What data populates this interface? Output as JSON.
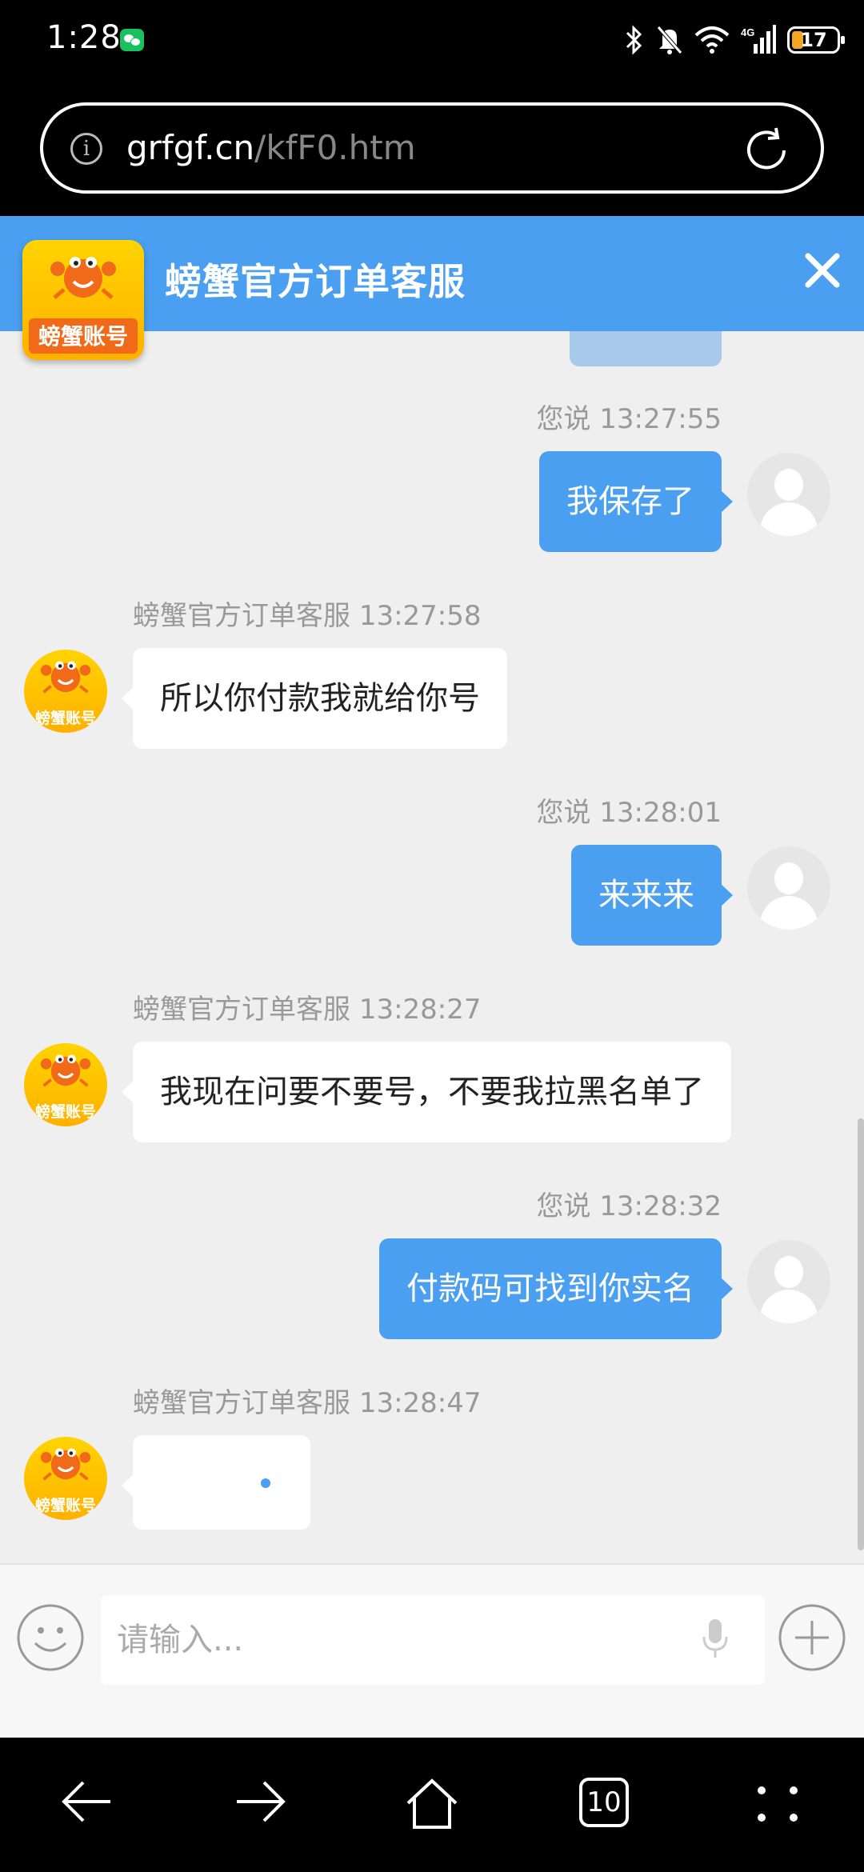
{
  "status_bar": {
    "time": "1:28",
    "battery": "17"
  },
  "browser": {
    "url_domain": "grfgf.cn",
    "url_path": "/kfF0.htm",
    "tabs_count": "10"
  },
  "chat": {
    "title": "螃蟹官方订单客服",
    "logo_text": "螃蟹账号",
    "messages": [
      {
        "sender": "您说",
        "time": "13:27:55",
        "text": "我保存了"
      },
      {
        "sender": "螃蟹官方订单客服",
        "time": "13:27:58",
        "text": "所以你付款我就给你号"
      },
      {
        "sender": "您说",
        "time": "13:28:01",
        "text": "来来来"
      },
      {
        "sender": "螃蟹官方订单客服",
        "time": "13:28:27",
        "text": "我现在问要不要号，不要我拉黑名单了"
      },
      {
        "sender": "您说",
        "time": "13:28:32",
        "text": "付款码可找到你实名"
      },
      {
        "sender": "螃蟹官方订单客服",
        "time": "13:28:47",
        "text": ""
      }
    ]
  },
  "input": {
    "placeholder": "请输入..."
  },
  "icons": {
    "wechat": "wechat-icon",
    "bluetooth": "bluetooth-icon",
    "mute": "bell-off-icon",
    "wifi": "wifi-icon",
    "signal": "signal-icon",
    "info": "info-icon",
    "reload": "reload-icon",
    "close": "close-icon",
    "emoji": "emoji-icon",
    "mic": "mic-icon",
    "plus": "plus-icon",
    "back": "back-arrow-icon",
    "forward": "forward-arrow-icon",
    "home": "home-icon",
    "menu": "menu-dots-icon"
  },
  "colors": {
    "accent": "#4a9ff0",
    "chat_bg": "#efeff0",
    "logo": "#ffc400"
  }
}
